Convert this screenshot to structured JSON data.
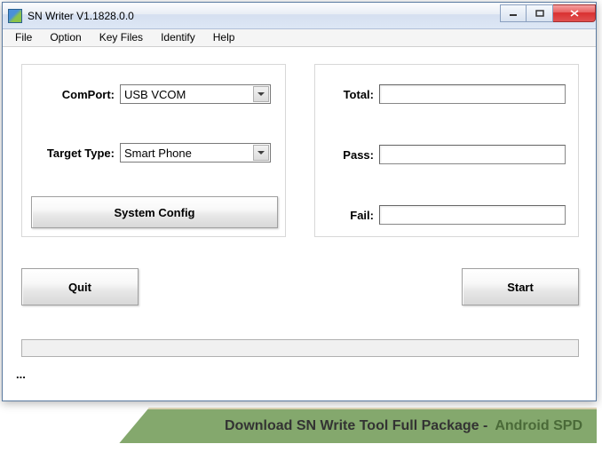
{
  "window": {
    "title": "SN Writer V1.1828.0.0"
  },
  "menu": {
    "file": "File",
    "option": "Option",
    "keyfiles": "Key Files",
    "identify": "Identify",
    "help": "Help"
  },
  "left_panel": {
    "comport_label": "ComPort:",
    "comport_value": "USB VCOM",
    "target_type_label": "Target Type:",
    "target_type_value": "Smart Phone",
    "system_config": "System Config"
  },
  "right_panel": {
    "total_label": "Total:",
    "total_value": "",
    "pass_label": "Pass:",
    "pass_value": "",
    "fail_label": "Fail:",
    "fail_value": ""
  },
  "buttons": {
    "quit": "Quit",
    "start": "Start"
  },
  "status_text": "...",
  "banner": {
    "text": "Download SN Write Tool Full Package - ",
    "brand": "Android SPD"
  }
}
